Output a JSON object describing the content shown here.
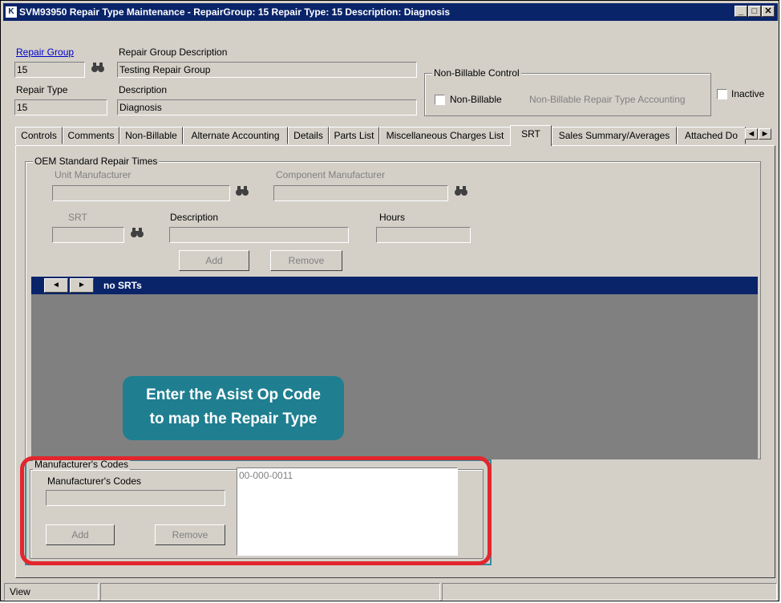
{
  "window": {
    "title": "SVM93950 Repair Type Maintenance - RepairGroup: 15 Repair Type: 15 Description: Diagnosis",
    "icon_glyph": "K",
    "controls": {
      "minimize": "_",
      "maximize": "□",
      "close": "✕"
    }
  },
  "header": {
    "repair_group_label": "Repair Group",
    "repair_group_value": "15",
    "repair_group_desc_label": "Repair Group Description",
    "repair_group_desc_value": "Testing Repair Group",
    "repair_type_label": "Repair Type",
    "repair_type_value": "15",
    "description_label": "Description",
    "description_value": "Diagnosis",
    "non_billable_control_title": "Non-Billable Control",
    "non_billable_label": "Non-Billable",
    "non_billable_checked": false,
    "non_billable_accounting_label": "Non-Billable Repair Type Accounting",
    "inactive_label": "Inactive",
    "inactive_checked": false
  },
  "tabs": [
    {
      "label": "Controls",
      "active": false
    },
    {
      "label": "Comments",
      "active": false
    },
    {
      "label": "Non-Billable",
      "active": false
    },
    {
      "label": "Alternate Accounting",
      "active": false
    },
    {
      "label": "Details",
      "active": false
    },
    {
      "label": "Parts List",
      "active": false
    },
    {
      "label": "Miscellaneous Charges List",
      "active": false
    },
    {
      "label": "SRT",
      "active": true
    },
    {
      "label": "Sales Summary/Averages",
      "active": false
    },
    {
      "label": "Attached Do",
      "active": false
    }
  ],
  "tab_scroll": {
    "left": "◄",
    "right": "►"
  },
  "srt": {
    "group_title": "OEM Standard Repair Times",
    "unit_manufacturer_label": "Unit Manufacturer",
    "component_manufacturer_label": "Component Manufacturer",
    "srt_label": "SRT",
    "description_label": "Description",
    "hours_label": "Hours",
    "add_label": "Add",
    "remove_label": "Remove"
  },
  "grid": {
    "prev": "◄",
    "next": "►",
    "caption": "no SRTs"
  },
  "callout": {
    "line1": "Enter the Asist Op Code",
    "line2": "to map the Repair Type"
  },
  "manufacturer_codes": {
    "group_title": "Manufacturer's Codes",
    "field_label": "Manufacturer's Codes",
    "add_label": "Add",
    "remove_label": "Remove",
    "list_items": [
      "00-000-0011"
    ]
  },
  "status": {
    "mode": "View"
  },
  "colors": {
    "title_bar": "#0a246a",
    "callout": "#1f7f91",
    "highlight_border": "#e3262d",
    "grid_background": "#808080",
    "window_face": "#d4d0c8"
  }
}
